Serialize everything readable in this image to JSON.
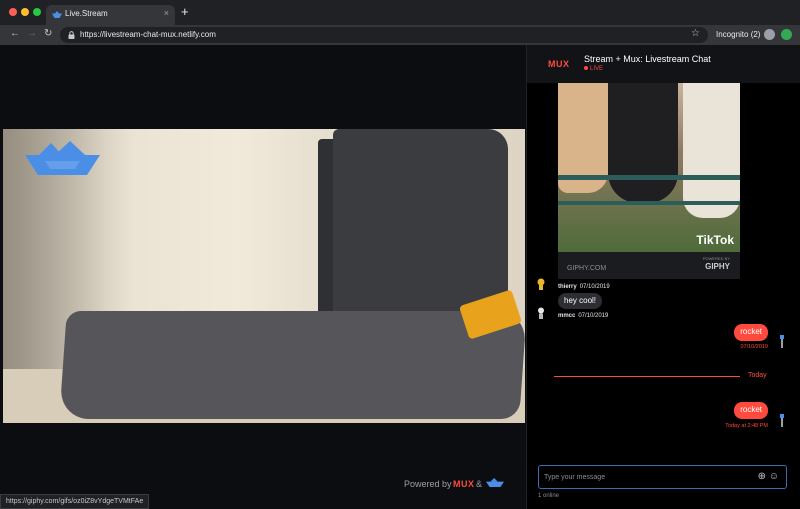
{
  "browser": {
    "tab_title": "Live.Stream",
    "tab_close": "×",
    "new_tab": "+",
    "url": "https://livestream-chat-mux.netlify.com",
    "incognito_label": "Incognito (2)",
    "status_url": "https://giphy.com/gifs/oz0iZ8vYdgeTVMtFAe"
  },
  "video": {
    "powered_by": "Powered by",
    "powered_brand": "MUX",
    "powered_amp": "&"
  },
  "chat": {
    "logo": "MUX",
    "title": "Stream + Mux: Livestream Chat",
    "live_badge": "LIVE",
    "gif": {
      "watermark": "TikTok",
      "site": "GIPHY.COM",
      "powered": "POWERED BY",
      "brand": "GIPHY"
    },
    "messages": [
      {
        "user": "thierry",
        "time": "07/10/2019"
      },
      {
        "text": "hey cool!",
        "user": "mmcc",
        "time": "07/10/2019"
      },
      {
        "text": "rocket",
        "time": "07/10/2019"
      },
      {
        "text": "rocket",
        "time": "Today at 2:48 PM"
      }
    ],
    "divider_label": "Today",
    "composer_placeholder": "Type your message",
    "online_count": "1 online"
  },
  "colors": {
    "accent": "#ff4a3d",
    "background": "#000000",
    "composer_border": "#3b6fb0"
  }
}
